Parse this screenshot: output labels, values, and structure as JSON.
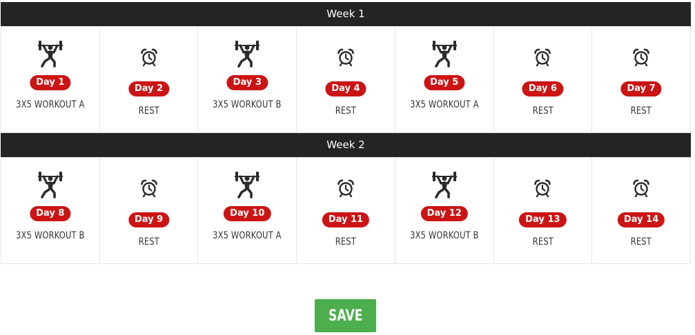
{
  "weeks": [
    {
      "title": "Week 1",
      "days": [
        {
          "label": "Day 1",
          "plan": "3X5 WORKOUT A",
          "type": "workout",
          "icon": "weightlifter-icon"
        },
        {
          "label": "Day 2",
          "plan": "REST",
          "type": "rest",
          "icon": "alarm-clock-icon"
        },
        {
          "label": "Day 3",
          "plan": "3X5 WORKOUT B",
          "type": "workout",
          "icon": "weightlifter-icon"
        },
        {
          "label": "Day 4",
          "plan": "REST",
          "type": "rest",
          "icon": "alarm-clock-icon"
        },
        {
          "label": "Day 5",
          "plan": "3X5 WORKOUT A",
          "type": "workout",
          "icon": "weightlifter-icon"
        },
        {
          "label": "Day 6",
          "plan": "REST",
          "type": "rest",
          "icon": "alarm-clock-icon"
        },
        {
          "label": "Day 7",
          "plan": "REST",
          "type": "rest",
          "icon": "alarm-clock-icon"
        }
      ]
    },
    {
      "title": "Week 2",
      "days": [
        {
          "label": "Day 8",
          "plan": "3X5 WORKOUT B",
          "type": "workout",
          "icon": "weightlifter-icon"
        },
        {
          "label": "Day 9",
          "plan": "REST",
          "type": "rest",
          "icon": "alarm-clock-icon"
        },
        {
          "label": "Day 10",
          "plan": "3X5 WORKOUT A",
          "type": "workout",
          "icon": "weightlifter-icon"
        },
        {
          "label": "Day 11",
          "plan": "REST",
          "type": "rest",
          "icon": "alarm-clock-icon"
        },
        {
          "label": "Day 12",
          "plan": "3X5 WORKOUT B",
          "type": "workout",
          "icon": "weightlifter-icon"
        },
        {
          "label": "Day 13",
          "plan": "REST",
          "type": "rest",
          "icon": "alarm-clock-icon"
        },
        {
          "label": "Day 14",
          "plan": "REST",
          "type": "rest",
          "icon": "alarm-clock-icon"
        }
      ]
    }
  ],
  "save_label": "SAVE",
  "colors": {
    "header_bg": "#242424",
    "badge": "#cc1414",
    "save": "#4cae4c",
    "icon": "#2b2b2b"
  }
}
